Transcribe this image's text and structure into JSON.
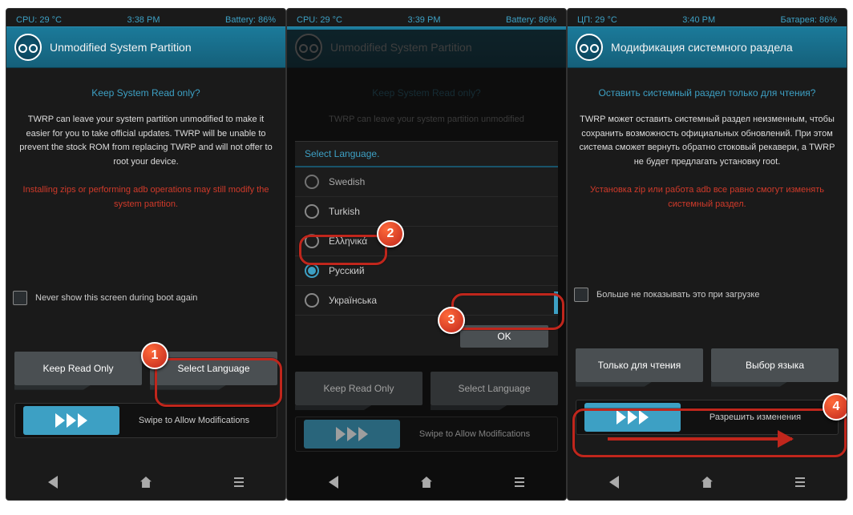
{
  "phones": [
    {
      "status": {
        "cpu": "CPU: 29 °C",
        "time": "3:38 PM",
        "bat": "Battery: 86%"
      },
      "title": "Unmodified System Partition",
      "question": "Keep System Read only?",
      "desc": "TWRP can leave your system partition unmodified to make it easier for you to take official updates. TWRP will be unable to prevent the stock ROM from replacing TWRP and will not offer to root your device.",
      "warning": "Installing zips or performing adb operations may still modify the system partition.",
      "never": "Never show this screen during boot again",
      "btn1": "Keep Read Only",
      "btn2": "Select Language",
      "swipe": "Swipe to Allow Modifications"
    },
    {
      "status": {
        "cpu": "CPU: 29 °C",
        "time": "3:39 PM",
        "bat": "Battery: 86%"
      },
      "title": "Unmodified System Partition",
      "question": "Keep System Read only?",
      "desc": "TWRP can leave your system partition unmodified",
      "btn1": "Keep Read Only",
      "btn2": "Select Language",
      "swipe": "Swipe to Allow Modifications",
      "lang_title": "Select Language.",
      "lang": [
        "Swedish",
        "Turkish",
        "Ελληνικά",
        "Русский",
        "Українська"
      ],
      "ok": "OK"
    },
    {
      "status": {
        "cpu": "ЦП: 29 °C",
        "time": "3:40 PM",
        "bat": "Батарея: 86%"
      },
      "title": "Модификация системного раздела",
      "question": "Оставить системный раздел только для чтения?",
      "desc": "TWRP может оставить системный раздел неизменным, чтобы сохранить возможность официальных обновлений. При этом система сможет вернуть обратно стоковый рекавери, а TWRP не будет предлагать установку root.",
      "warning": "Установка zip или работа adb все равно смогут изменять системный раздел.",
      "never": "Больше не показывать это при загрузке",
      "btn1": "Только для чтения",
      "btn2": "Выбор языка",
      "swipe": "Разрешить изменения"
    }
  ]
}
